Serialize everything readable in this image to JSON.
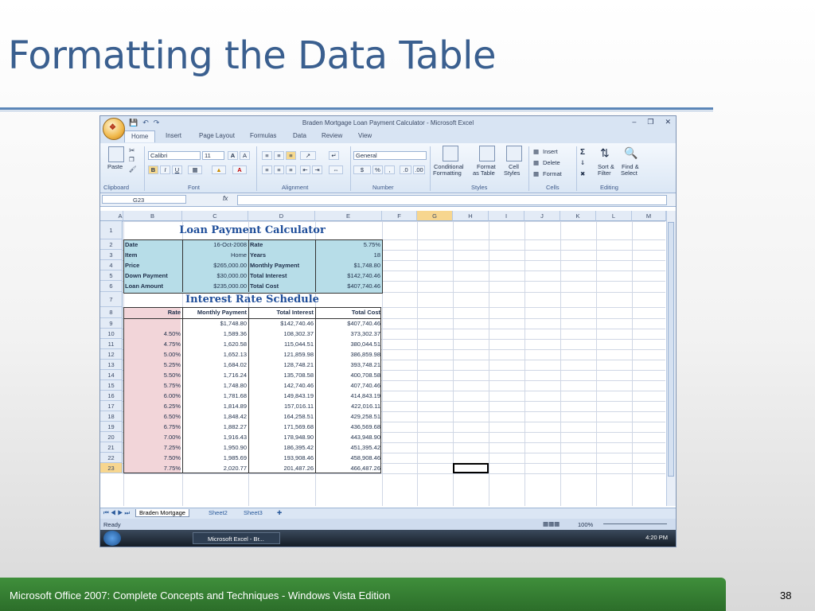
{
  "slide": {
    "title": "Formatting the Data Table",
    "footer": "Microsoft Office 2007: Complete Concepts and Techniques - Windows Vista Edition",
    "page_number": "38"
  },
  "window": {
    "title": "Braden Mortgage Loan Payment Calculator - Microsoft Excel",
    "ribbon_tabs": [
      "Home",
      "Insert",
      "Page Layout",
      "Formulas",
      "Data",
      "Review",
      "View"
    ],
    "active_tab": "Home"
  },
  "ribbon": {
    "paste": "Paste",
    "font_name": "Calibri",
    "font_size": "11",
    "number_format": "General",
    "conditional": "Conditional",
    "conditional2": "Formatting",
    "format_as": "Format",
    "format_as2": "as Table",
    "cell": "Cell",
    "cell2": "Styles",
    "insert": "Insert",
    "delete": "Delete",
    "format": "Format",
    "sort": "Sort &",
    "sort2": "Filter",
    "find": "Find &",
    "find2": "Select",
    "groups": [
      "Clipboard",
      "Font",
      "Alignment",
      "Number",
      "Styles",
      "Cells",
      "Editing"
    ]
  },
  "formula_bar": {
    "name_box": "G23",
    "fx": "fx",
    "value": ""
  },
  "columns": [
    "A",
    "B",
    "C",
    "D",
    "E",
    "F",
    "G",
    "H",
    "I",
    "J",
    "K",
    "L",
    "M"
  ],
  "rows": [
    "1",
    "2",
    "3",
    "4",
    "5",
    "6",
    "7",
    "8",
    "9",
    "10",
    "11",
    "12",
    "13",
    "14",
    "15",
    "16",
    "17",
    "18",
    "19",
    "20",
    "21",
    "22",
    "23"
  ],
  "sheet": {
    "title1": "Loan Payment Calculator",
    "title2": "Interest Rate Schedule",
    "inputs": [
      {
        "label": "Date",
        "value": "16-Oct-2008",
        "label2": "Rate",
        "value2": "5.75%"
      },
      {
        "label": "Item",
        "value": "Home",
        "label2": "Years",
        "value2": "18"
      },
      {
        "label": "Price",
        "value": "$265,000.00",
        "label2": "Monthly Payment",
        "value2": "$1,748.80"
      },
      {
        "label": "Down Payment",
        "value": "$30,000.00",
        "label2": "Total Interest",
        "value2": "$142,740.46"
      },
      {
        "label": "Loan Amount",
        "value": "$235,000.00",
        "label2": "Total Cost",
        "value2": "$407,740.46"
      }
    ],
    "schedule_headers": [
      "Rate",
      "Monthly Payment",
      "Total Interest",
      "Total Cost"
    ],
    "schedule": [
      [
        "",
        "$1,748.80",
        "$142,740.46",
        "$407,740.46"
      ],
      [
        "4.50%",
        "1,589.36",
        "108,302.37",
        "373,302.37"
      ],
      [
        "4.75%",
        "1,620.58",
        "115,044.51",
        "380,044.51"
      ],
      [
        "5.00%",
        "1,652.13",
        "121,859.98",
        "386,859.98"
      ],
      [
        "5.25%",
        "1,684.02",
        "128,748.21",
        "393,748.21"
      ],
      [
        "5.50%",
        "1,716.24",
        "135,708.58",
        "400,708.58"
      ],
      [
        "5.75%",
        "1,748.80",
        "142,740.46",
        "407,740.46"
      ],
      [
        "6.00%",
        "1,781.68",
        "149,843.19",
        "414,843.19"
      ],
      [
        "6.25%",
        "1,814.89",
        "157,016.11",
        "422,016.11"
      ],
      [
        "6.50%",
        "1,848.42",
        "164,258.51",
        "429,258.51"
      ],
      [
        "6.75%",
        "1,882.27",
        "171,569.68",
        "436,569.68"
      ],
      [
        "7.00%",
        "1,916.43",
        "178,948.90",
        "443,948.90"
      ],
      [
        "7.25%",
        "1,950.90",
        "186,395.42",
        "451,395.42"
      ],
      [
        "7.50%",
        "1,985.69",
        "193,908.46",
        "458,908.46"
      ],
      [
        "7.75%",
        "2,020.77",
        "201,487.26",
        "466,487.26"
      ]
    ]
  },
  "sheet_tabs": [
    "Braden Mortgage",
    "Sheet2",
    "Sheet3"
  ],
  "status": {
    "ready": "Ready",
    "zoom": "100%"
  },
  "taskbar": {
    "app": "Microsoft Excel - Br...",
    "clock": "4:20 PM"
  }
}
